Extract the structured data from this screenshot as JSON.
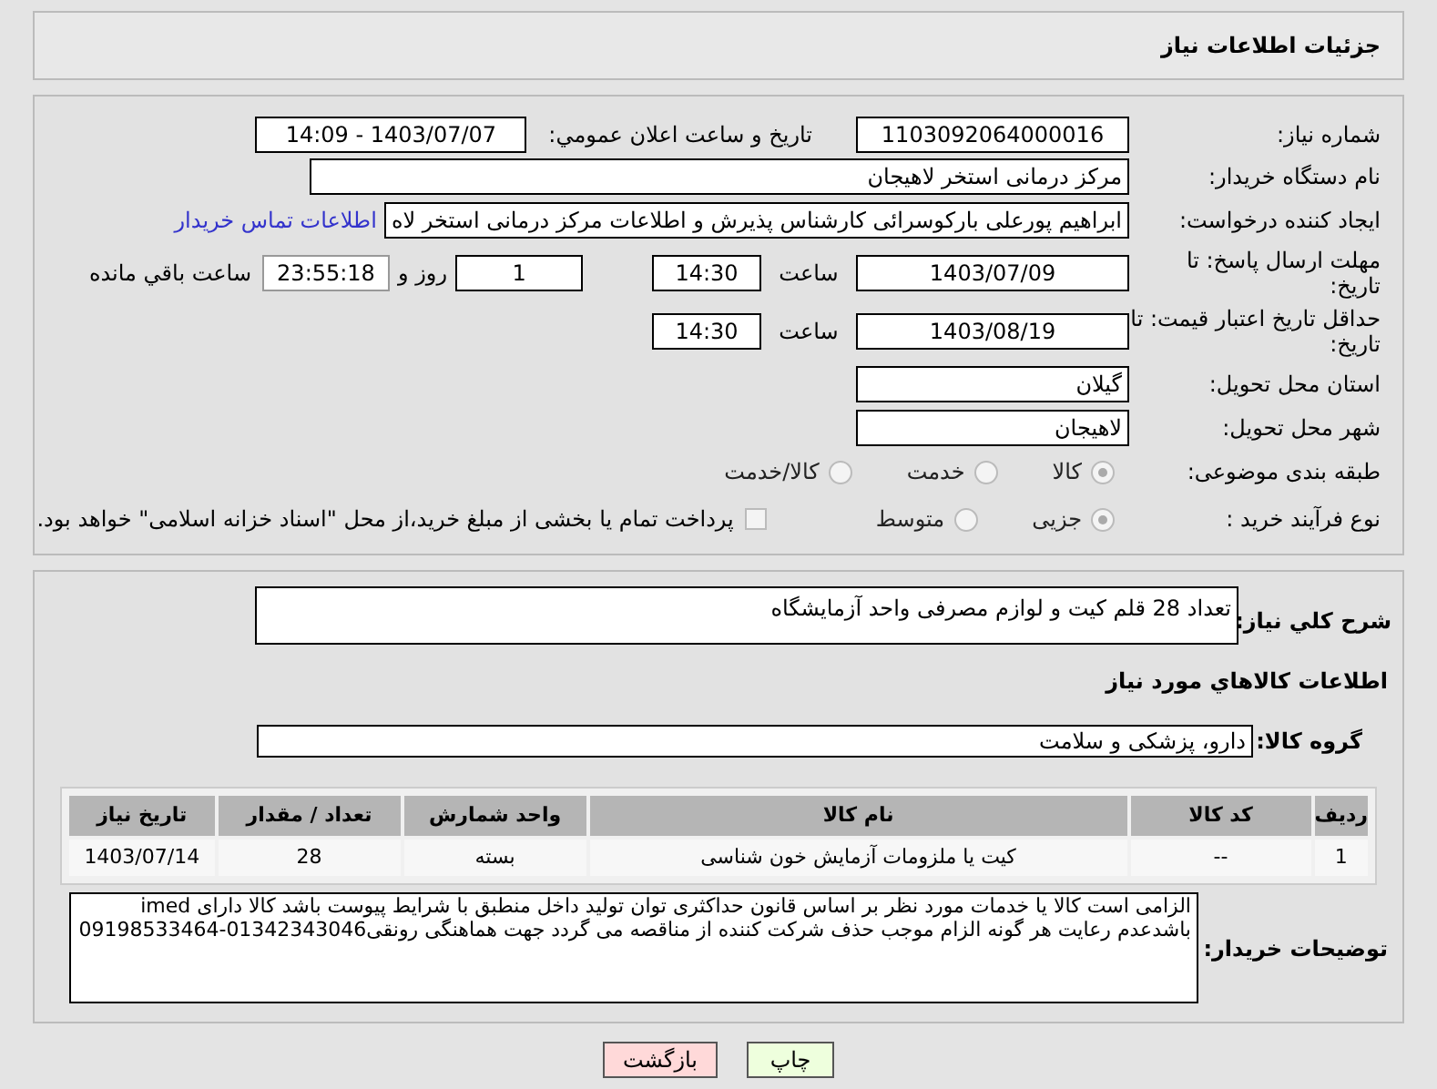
{
  "header": {
    "title": "جزئیات اطلاعات نیاز"
  },
  "need_number": {
    "label": "شماره نیاز:",
    "value": "1103092064000016"
  },
  "announce": {
    "label": "تاریخ و ساعت اعلان عمومي:",
    "value": "1403/07/07 - 14:09"
  },
  "buyer": {
    "label": "نام دستگاه خريدار:",
    "value": "مرکز درمانی استخر لاهیجان"
  },
  "creator": {
    "label": "ايجاد کننده درخواست:",
    "value": "ابراهیم پورعلی بارکوسرائی کارشناس پذیرش و اطلاعات مرکز درمانی استخر لاه",
    "link": "اطلاعات تماس خریدار"
  },
  "deadline": {
    "label": "مهلت ارسال پاسخ: تا تاریخ:",
    "date": "1403/07/09",
    "time_label": "ساعت",
    "time": "14:30",
    "days": "1",
    "days_label": "روز و",
    "remaining": "23:55:18",
    "remaining_label": "ساعت باقي مانده"
  },
  "validity": {
    "label": "حداقل تاريخ اعتبار قيمت: تا تاريخ:",
    "date": "1403/08/19",
    "time_label": "ساعت",
    "time": "14:30"
  },
  "province": {
    "label": "استان محل تحويل:",
    "value": "گیلان"
  },
  "city": {
    "label": "شهر محل تحويل:",
    "value": "لاهیجان"
  },
  "category": {
    "label": "طبقه بندی موضوعی:",
    "options": [
      {
        "label": "کالا",
        "selected": true
      },
      {
        "label": "خدمت",
        "selected": false
      },
      {
        "label": "کالا/خدمت",
        "selected": false
      }
    ]
  },
  "process": {
    "label": "نوع فرآیند خرید :",
    "options": [
      {
        "label": "جزیی",
        "selected": true
      },
      {
        "label": "متوسط",
        "selected": false
      }
    ],
    "payment": {
      "label": "پرداخت تمام یا بخشی از مبلغ خرید،از محل \"اسناد خزانه اسلامی\" خواهد بود.",
      "checked": false
    }
  },
  "summary": {
    "label": "شرح کلي نياز:",
    "value": "تعداد 28 قلم کیت و لوازم مصرفی واحد آزمایشگاه"
  },
  "items_heading": "اطلاعات کالاهاي مورد نياز",
  "group": {
    "label": "گروه کالا:",
    "value": "دارو، پزشکی و سلامت"
  },
  "table": {
    "columns": [
      "رديف",
      "کد کالا",
      "نام کالا",
      "واحد شمارش",
      "تعداد / مقدار",
      "تاريخ نياز"
    ],
    "rows": [
      [
        "1",
        "--",
        "کیت یا ملزومات آزمایش خون شناسی",
        "بسته",
        "28",
        "1403/07/14"
      ]
    ]
  },
  "notes": {
    "label": "توضيحات خريدار:",
    "value": "الزامی است کالا یا خدمات مورد نظر بر اساس قانون حداکثری توان تولید داخل منطبق با شرایط پیوست باشد کالا دارای imed باشدعدم رعایت هر گونه الزام موجب حذف شرکت کننده از مناقصه می گردد جهت هماهنگی رونقی01342343046-09198533464"
  },
  "buttons": [
    {
      "label": "چاپ",
      "kind": "print"
    },
    {
      "label": "بازگشت",
      "kind": "back"
    }
  ]
}
